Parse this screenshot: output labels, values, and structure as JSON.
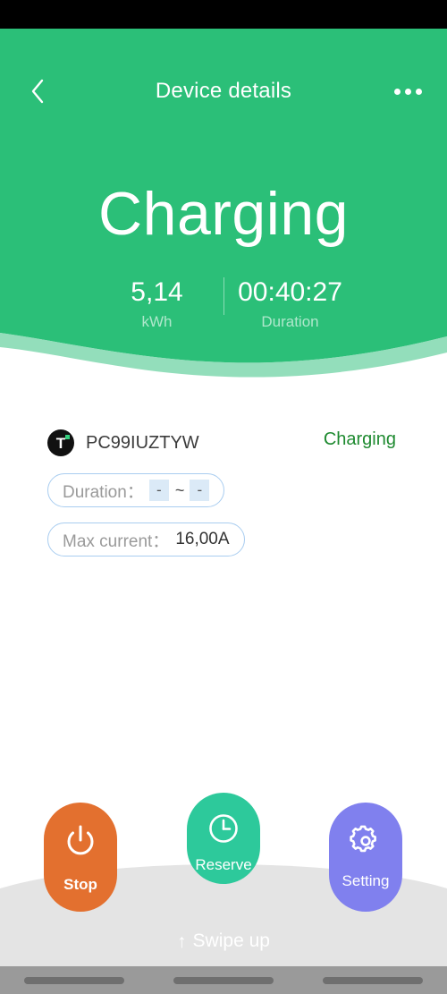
{
  "header": {
    "title": "Device details",
    "back_icon": "chevron-left-icon",
    "more_icon": "more-options-icon"
  },
  "hero": {
    "state": "Charging",
    "energy": {
      "value": "5,14",
      "label": "kWh"
    },
    "duration": {
      "value": "00:40:27",
      "label": "Duration"
    },
    "background_color": "#2bbf78"
  },
  "device": {
    "brand_icon": "tuya-logo-icon",
    "brand_letter": "T",
    "id": "PC99IUZTYW",
    "status": "Charging",
    "status_color": "#1e8a30"
  },
  "chips": {
    "duration": {
      "label": "Duration：",
      "start": "-",
      "separator": "~",
      "end": "-"
    },
    "max_current": {
      "label": "Max current：",
      "value": "16,00A"
    }
  },
  "actions": [
    {
      "id": "stop",
      "label": "Stop",
      "icon": "power-icon",
      "color": "#e3702f"
    },
    {
      "id": "reserve",
      "label": "Reserve",
      "icon": "clock-icon",
      "color": "#2dc99b"
    },
    {
      "id": "setting",
      "label": "Setting",
      "icon": "gear-icon",
      "color": "#8080ee"
    }
  ],
  "swipe": {
    "arrow": "↑",
    "label": "Swipe up"
  }
}
